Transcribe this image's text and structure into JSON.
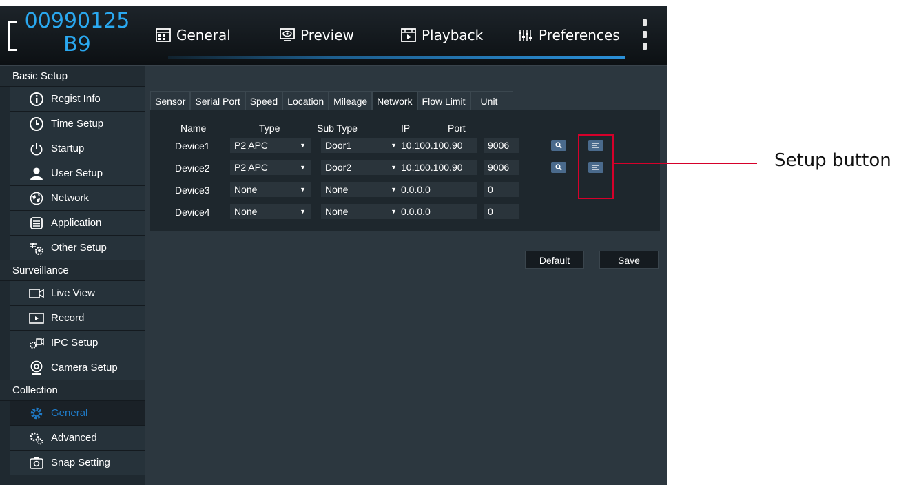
{
  "header": {
    "device_id_line1": "00990125",
    "device_id_line2": "B9",
    "tabs": [
      {
        "label": "General",
        "icon": "general-grid-icon"
      },
      {
        "label": "Preview",
        "icon": "preview-eye-icon"
      },
      {
        "label": "Playback",
        "icon": "playback-film-icon"
      },
      {
        "label": "Preferences",
        "icon": "preferences-sliders-icon"
      }
    ],
    "active_tab": "Preferences"
  },
  "sidebar": {
    "sections": [
      {
        "label": "Basic Setup"
      },
      {
        "label": "Surveillance"
      },
      {
        "label": "Collection"
      }
    ],
    "items": [
      {
        "label": "Regist Info",
        "icon": "info-icon"
      },
      {
        "label": "Time Setup",
        "icon": "clock-icon"
      },
      {
        "label": "Startup",
        "icon": "power-icon"
      },
      {
        "label": "User Setup",
        "icon": "user-icon"
      },
      {
        "label": "Network",
        "icon": "network-globe-icon"
      },
      {
        "label": "Application",
        "icon": "application-icon"
      },
      {
        "label": "Other Setup",
        "icon": "other-setup-icon"
      },
      {
        "label": "Live View",
        "icon": "camera-icon"
      },
      {
        "label": "Record",
        "icon": "record-icon"
      },
      {
        "label": "IPC Setup",
        "icon": "ipc-setup-icon"
      },
      {
        "label": "Camera Setup",
        "icon": "webcam-icon"
      },
      {
        "label": "General",
        "icon": "gear-icon",
        "active": true
      },
      {
        "label": "Advanced",
        "icon": "gears-icon"
      },
      {
        "label": "Snap Setting",
        "icon": "snapshot-icon"
      }
    ]
  },
  "subtabs": [
    "Sensor",
    "Serial Port",
    "Speed",
    "Location",
    "Mileage",
    "Network",
    "Flow Limit",
    "Unit"
  ],
  "active_subtab": "Network",
  "table": {
    "headers": {
      "name": "Name",
      "type": "Type",
      "subtype": "Sub Type",
      "ip": "IP",
      "port": "Port"
    },
    "rows": [
      {
        "name": "Device1",
        "type": "P2 APC",
        "subtype": "Door1",
        "ip": "10.100.100.90",
        "port": "9006",
        "has_buttons": true
      },
      {
        "name": "Device2",
        "type": "P2 APC",
        "subtype": "Door2",
        "ip": "10.100.100.90",
        "port": "9006",
        "has_buttons": true
      },
      {
        "name": "Device3",
        "type": "None",
        "subtype": "None",
        "ip": "0.0.0.0",
        "port": "0",
        "has_buttons": false
      },
      {
        "name": "Device4",
        "type": "None",
        "subtype": "None",
        "ip": "0.0.0.0",
        "port": "0",
        "has_buttons": false
      }
    ]
  },
  "buttons": {
    "default": "Default",
    "save": "Save"
  },
  "annotation": {
    "label": "Setup button",
    "color": "#d6002a"
  },
  "colors": {
    "accent": "#2aa8f0",
    "active_item": "#1f7bc8",
    "button_blue": "#4a6a8c"
  }
}
